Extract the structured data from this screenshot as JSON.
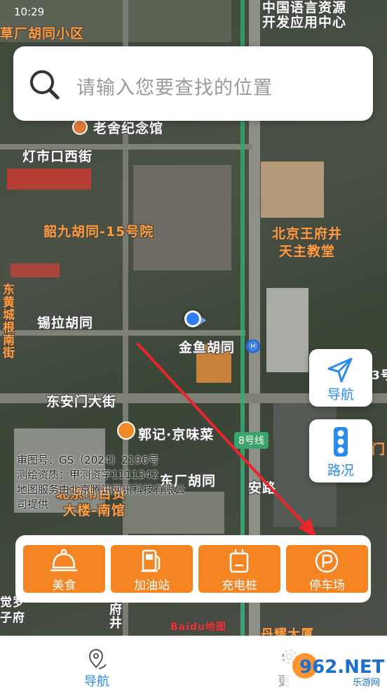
{
  "status_bar": {
    "time": "10:29"
  },
  "search": {
    "placeholder": "请输入您要查找的位置"
  },
  "map": {
    "labels": {
      "caochang": "草厂胡同小区",
      "zhongguo_1": "中国语言资源",
      "zhongguo_2": "开发应用中心",
      "laoshe": "老舍纪念馆",
      "dengshikou": "灯市口西街",
      "shaojiu": "韶九胡同-15号院",
      "wangfujing_1": "北京王府井",
      "wangfujing_2": "天主教堂",
      "xila": "锡拉胡同",
      "jinyu": "金鱼胡同",
      "dongan": "东安门大街",
      "guoji": "郭记·京味菜",
      "line8": "8号线",
      "dongchang": "东厂胡同",
      "baihuo_1": "北京市百货",
      "baihuo_2": "大楼-南馆",
      "anlu": "安路",
      "left_vertical": "东黄城根南街",
      "fujing": "府井",
      "dayao": "丹耀大厦",
      "jueluo_1": "觉罗",
      "jueluo_2": "子府",
      "men": "门",
      "num3": "3号"
    },
    "attribution": {
      "line1": "审图号：GS（2024）2196号",
      "line2": "测绘资质：甲测资字1111342",
      "line3": "地图服务由北京腾讯网讯科技有限公",
      "line4": "司提供"
    },
    "logo": "Baidu地图"
  },
  "side_buttons": {
    "navigate": {
      "label": "导航",
      "icon": "navigation-arrow-icon"
    },
    "traffic": {
      "label": "路况",
      "icon": "traffic-light-icon"
    }
  },
  "categories": [
    {
      "label": "美食",
      "icon": "food-cloche-icon"
    },
    {
      "label": "加油站",
      "icon": "gas-pump-icon"
    },
    {
      "label": "充电桩",
      "icon": "charging-station-icon"
    },
    {
      "label": "停车场",
      "icon": "parking-icon"
    }
  ],
  "bottom_nav": {
    "navigate": {
      "label": "导航",
      "icon": "map-pin-icon"
    },
    "more": {
      "label": "更",
      "icon": "gear-icon"
    }
  },
  "watermark": {
    "text": "962.NET",
    "sub": "乐游网"
  },
  "colors": {
    "accent_blue": "#2b8bea",
    "category_orange": "#f58422",
    "arrow_red": "#e8262b"
  }
}
